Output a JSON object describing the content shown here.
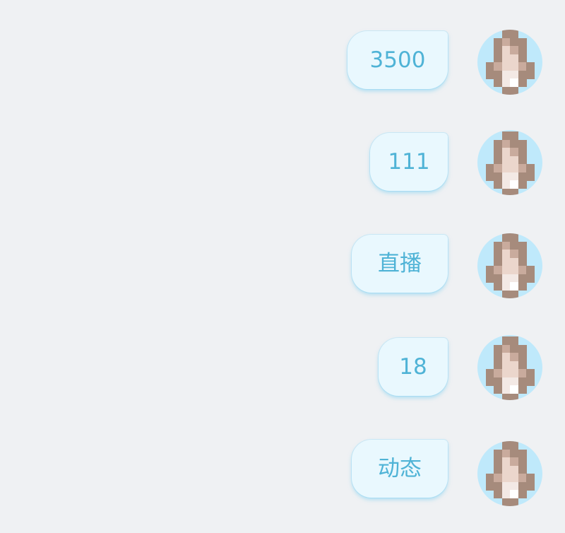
{
  "messages": [
    {
      "text": "3500",
      "avatar": "user-avatar"
    },
    {
      "text": "111",
      "avatar": "user-avatar"
    },
    {
      "text": "直播",
      "avatar": "user-avatar"
    },
    {
      "text": "18",
      "avatar": "user-avatar"
    },
    {
      "text": "动态",
      "avatar": "user-avatar"
    }
  ],
  "colors": {
    "background": "#eff1f3",
    "bubble": "#e9f8fe",
    "bubble_text": "#4fb3d6",
    "avatar_bg": "#bfe9fb"
  }
}
